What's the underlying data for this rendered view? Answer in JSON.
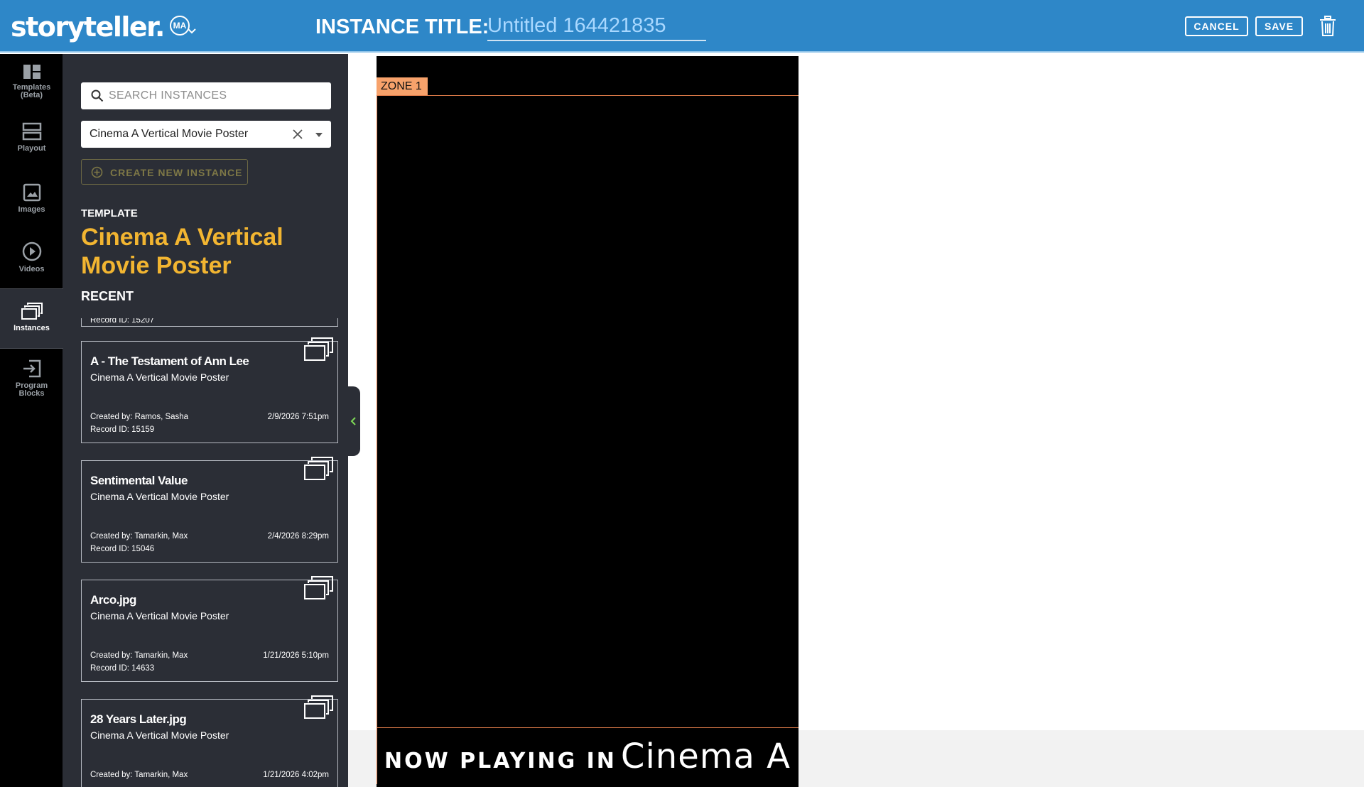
{
  "header": {
    "logo": "storyteller.",
    "avatar": "MA",
    "instance_title_label": "INSTANCE TITLE:",
    "instance_title_value": "Untitled 164421835",
    "cancel": "CANCEL",
    "save": "SAVE"
  },
  "rail": [
    {
      "label": "Templates (Beta)",
      "icon": "templates-icon"
    },
    {
      "label": "Playout",
      "icon": "playout-icon"
    },
    {
      "label": "Images",
      "icon": "image-icon"
    },
    {
      "label": "Videos",
      "icon": "play-circle-icon"
    },
    {
      "label": "Instances",
      "icon": "instances-icon",
      "active": true
    },
    {
      "label": "Program Blocks",
      "icon": "program-blocks-icon"
    }
  ],
  "panel": {
    "search_placeholder": "SEARCH INSTANCES",
    "template_select": "Cinema A Vertical Movie Poster",
    "create_button": "CREATE NEW INSTANCE",
    "template_label": "TEMPLATE",
    "template_name": "Cinema A Vertical Movie Poster",
    "recent_label": "RECENT",
    "partial_record": "Record ID: 15207",
    "cards": [
      {
        "title": "A - The Testament of Ann Lee",
        "subtitle": "Cinema A Vertical Movie Poster",
        "created_by": "Created by: Ramos, Sasha",
        "date": "2/9/2026 7:51pm",
        "record": "Record ID: 15159"
      },
      {
        "title": "Sentimental Value",
        "subtitle": "Cinema A Vertical Movie Poster",
        "created_by": "Created by: Tamarkin, Max",
        "date": "2/4/2026 8:29pm",
        "record": "Record ID: 15046"
      },
      {
        "title": "Arco.jpg",
        "subtitle": "Cinema A Vertical Movie Poster",
        "created_by": "Created by: Tamarkin, Max",
        "date": "1/21/2026 5:10pm",
        "record": "Record ID: 14633"
      },
      {
        "title": "28 Years Later.jpg",
        "subtitle": "Cinema A Vertical Movie Poster",
        "created_by": "Created by: Tamarkin, Max",
        "date": "1/21/2026 4:02pm",
        "record": ""
      }
    ]
  },
  "canvas": {
    "zone_label": "ZONE 1",
    "now_playing_prefix": "NOW PLAYING IN",
    "now_playing_location": "Cinema A"
  },
  "colors": {
    "header_bg": "#2e87c8",
    "panel_bg": "#2b2e36",
    "accent_gold": "#f2b531",
    "zone_orange": "#f7a26b"
  }
}
